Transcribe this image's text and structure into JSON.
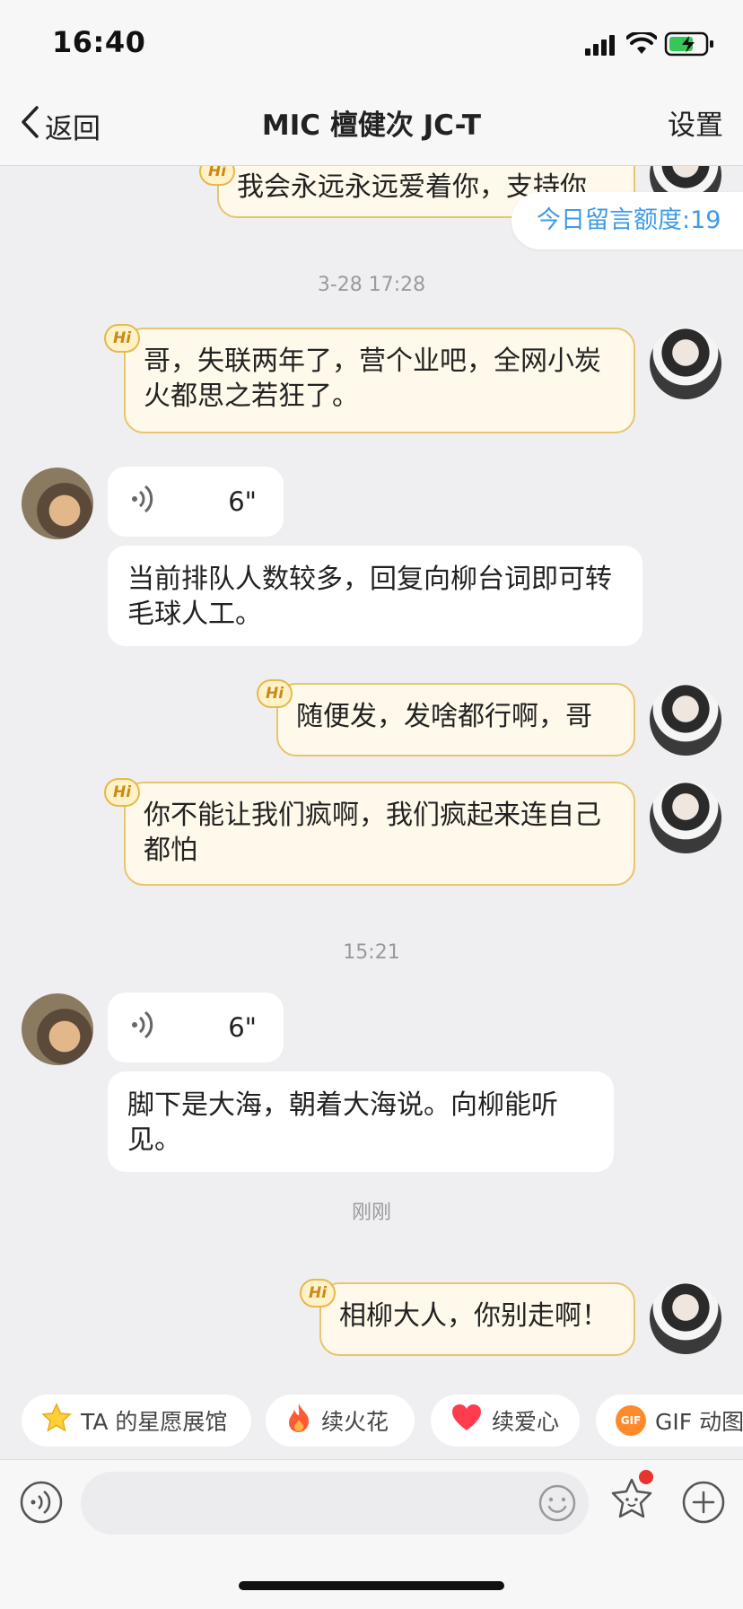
{
  "status": {
    "time": "16:40"
  },
  "nav": {
    "back_label": "返回",
    "title": "MIC 檀健次 JC-T",
    "settings_label": "设置"
  },
  "quota_label": "今日留言额度:19",
  "messages": [
    {
      "type": "mine",
      "text": "我会永远永远爱着你，支持你"
    },
    {
      "type": "timestamp",
      "text": "3-28 17:28"
    },
    {
      "type": "mine",
      "text": "哥，失联两年了，营个业吧，全网小炭火都思之若狂了。"
    },
    {
      "type": "voice",
      "duration": "6\""
    },
    {
      "type": "theirs",
      "text": "当前排队人数较多，回复向柳台词即可转毛球人工。"
    },
    {
      "type": "mine",
      "text": "随便发，发啥都行啊，哥"
    },
    {
      "type": "mine",
      "text": "你不能让我们疯啊，我们疯起来连自己都怕"
    },
    {
      "type": "timestamp",
      "text": "15:21"
    },
    {
      "type": "voice",
      "duration": "6\""
    },
    {
      "type": "theirs",
      "text": "脚下是大海，朝着大海说。向柳能听见。"
    },
    {
      "type": "timestamp",
      "text": "刚刚"
    },
    {
      "type": "mine",
      "text": "相柳大人，你别走啊！"
    }
  ],
  "hi_badge": "Hi",
  "chips": [
    {
      "label": "TA 的星愿展馆",
      "icon": "star-icon"
    },
    {
      "label": "续火花",
      "icon": "fire-icon"
    },
    {
      "label": "续爱心",
      "icon": "heart-icon"
    },
    {
      "label": "GIF 动图",
      "icon": "gif-icon",
      "badge": "GIF"
    }
  ],
  "colors": {
    "accent_blue": "#3f9ae8",
    "bubble_mine": "#fff9eb",
    "bubble_mine_border": "#e7c56f",
    "notification_dot": "#e8332f"
  }
}
